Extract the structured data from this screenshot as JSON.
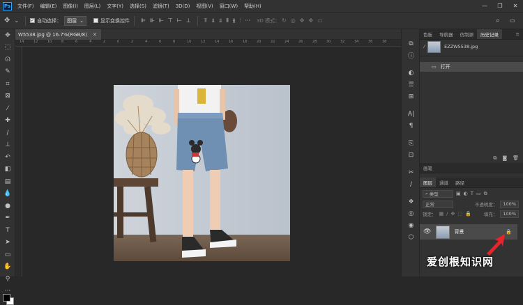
{
  "menubar": {
    "items": [
      "文件(F)",
      "编辑(E)",
      "图像(I)",
      "图层(L)",
      "文字(Y)",
      "选择(S)",
      "滤镜(T)",
      "3D(D)",
      "视图(V)",
      "窗口(W)",
      "帮助(H)"
    ]
  },
  "options": {
    "auto_select_label": "自动选择：",
    "auto_select_value": "图层",
    "show_transform_label": "显示变换控件",
    "mode_3d_label": "3D 模式："
  },
  "document": {
    "tab_title": "W5538.jpg @ 16.7%(RGB/8)",
    "ruler_ticks": [
      "14",
      "12",
      "10",
      "8",
      "6",
      "4",
      "2",
      "0",
      "2",
      "4",
      "6",
      "8",
      "10",
      "12",
      "14",
      "16",
      "18",
      "20",
      "22",
      "24",
      "26",
      "28",
      "30",
      "32",
      "34",
      "36",
      "38"
    ]
  },
  "history": {
    "tabs": [
      "色板",
      "导航器",
      "仿制源",
      "历史记录"
    ],
    "source_name": "EZZW5538.jpg",
    "open_label": "打开"
  },
  "layers": {
    "group_tab": "画笔",
    "tabs": [
      "图层",
      "通道",
      "路径"
    ],
    "kind_label": "类型",
    "blend_mode": "正常",
    "opacity_label": "不透明度：",
    "opacity_value": "100%",
    "lock_label": "锁定：",
    "fill_label": "填充：",
    "fill_value": "100%",
    "layer_name": "背景"
  },
  "watermark": "爱创根知识网",
  "colors": {
    "accent_blue": "#31a8ff",
    "panel_bg": "#323232",
    "canvas_bg": "#282828",
    "arrow_red": "#e8232a"
  }
}
